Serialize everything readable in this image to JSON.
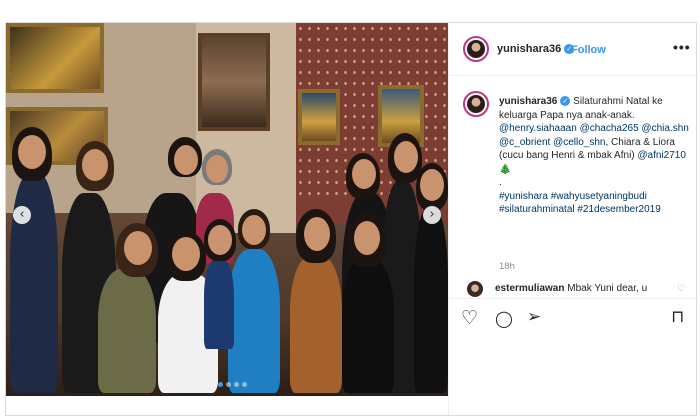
{
  "post": {
    "username": "yunishara36",
    "follow_label": "Follow",
    "more_label": "•••",
    "caption": {
      "username": "yunishara36",
      "line1": "Silaturahmi Natal ke keluarga Papa nya anak-anak.",
      "mentions1": "@henry.siahaaan @chacha265 @chia.shn @c_obrient @cello_shn",
      "names": ", Chiara & Liora (cucu bang Henri & mbak Afni)",
      "mention2": "@afni2710",
      "emoji": "🎄",
      "dot": ".",
      "hashtags": "#yunishara #wahyusetyaningbudi #silaturahminatal #21desember2019"
    },
    "time": "18h",
    "comment": {
      "username": "estermuliawan",
      "text": "Mbak Yuni dear, u"
    }
  },
  "icons": {
    "verified": "✓",
    "prev": "‹",
    "next": "›",
    "heart": "♡",
    "comment": "◯",
    "share": "➢",
    "bookmark": "⊓"
  }
}
